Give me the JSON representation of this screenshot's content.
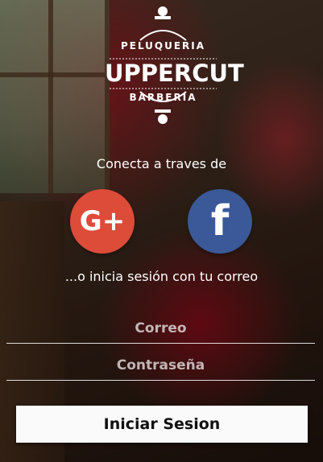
{
  "logo": {
    "top_text": "PELUQUERIA",
    "main_text": "UPPERCUT",
    "bottom_text": "BARBERIA"
  },
  "connect_label": "Conecta a traves de",
  "social": {
    "google_label": "G+",
    "facebook_label": "f",
    "google_color": "#dd4b39",
    "facebook_color": "#3b5998"
  },
  "email_label": "...o inicia sesión con tu correo",
  "form": {
    "email_placeholder": "Correo",
    "password_placeholder": "Contraseña",
    "submit_label": "Iniciar Sesion"
  }
}
